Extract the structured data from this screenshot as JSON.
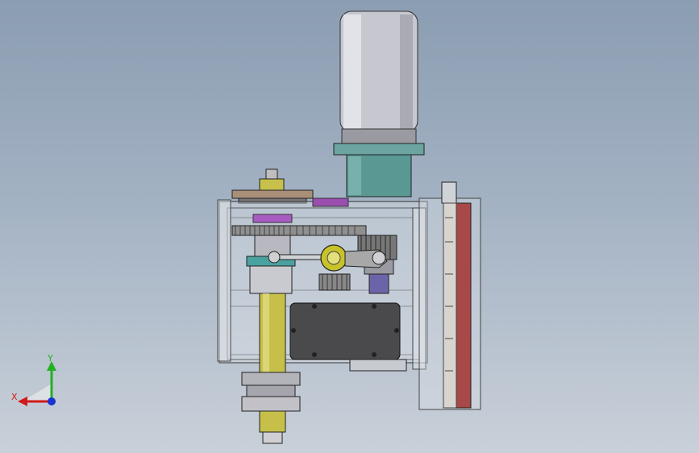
{
  "viewport": {
    "background_top": "#8b9db2",
    "background_bottom": "#c9d0d9"
  },
  "triad": {
    "x_label": "X",
    "y_label": "Y",
    "x_color": "#d11a1a",
    "y_color": "#22b022",
    "z_color": "#1a33d1"
  },
  "model": {
    "motor_color": "#c9c9d0",
    "flange_color": "#4f8f8c",
    "gearbox_color": "#e6e9ee",
    "shaft_color": "#b9b33a",
    "gear_color": "#7a7a7a",
    "cover_color": "#4a4a4a",
    "plate_color": "#a84848",
    "ring_color": "#9a8570",
    "highlight_color": "#9a4fb0",
    "lever_knob_color": "#c8c22a"
  }
}
